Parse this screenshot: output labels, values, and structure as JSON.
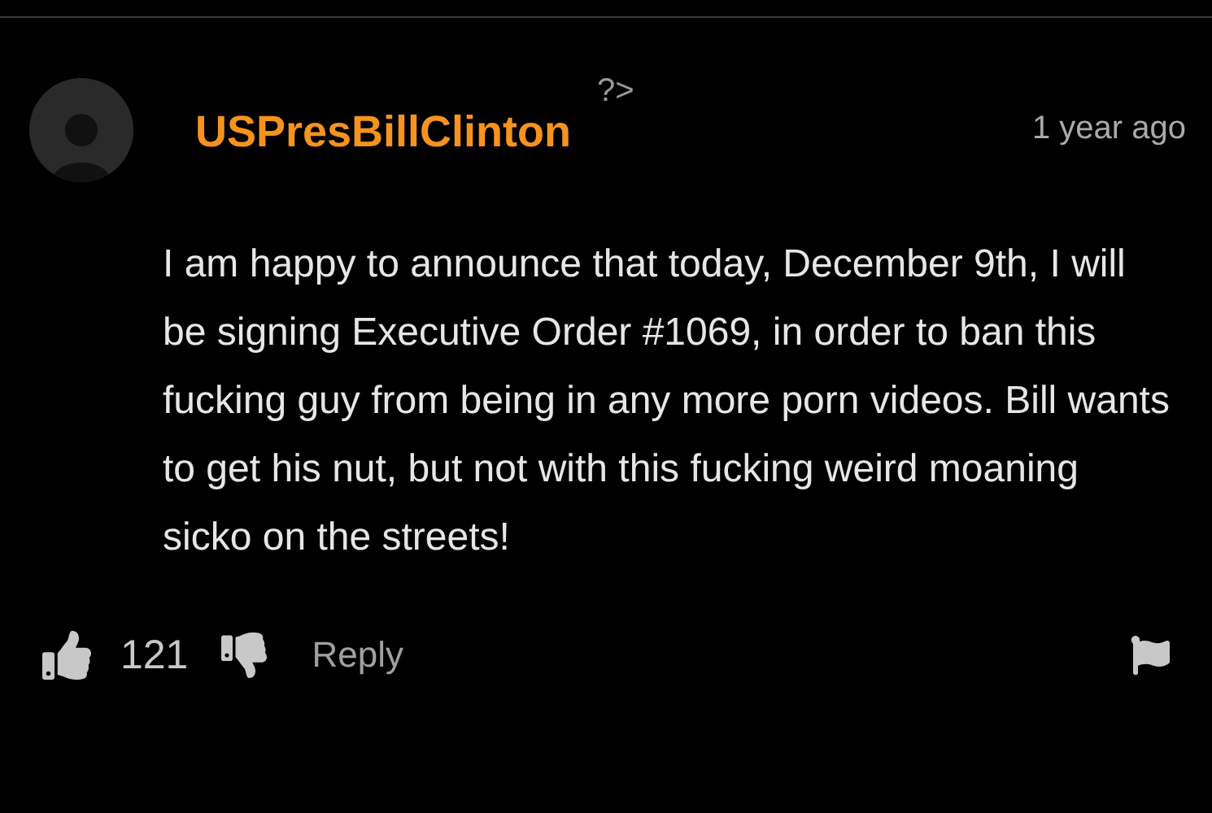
{
  "comment": {
    "author": "USPresBillClinton",
    "marker": "?>",
    "time": "1 year ago",
    "body": "I am happy to announce that today, December 9th, I will be signing Executive Order #1069, in order to ban this fucking guy from being in any more porn videos. Bill wants to get his nut, but not with this fucking weird moaning sicko on the streets!",
    "likes": "121",
    "reply": "Reply"
  }
}
